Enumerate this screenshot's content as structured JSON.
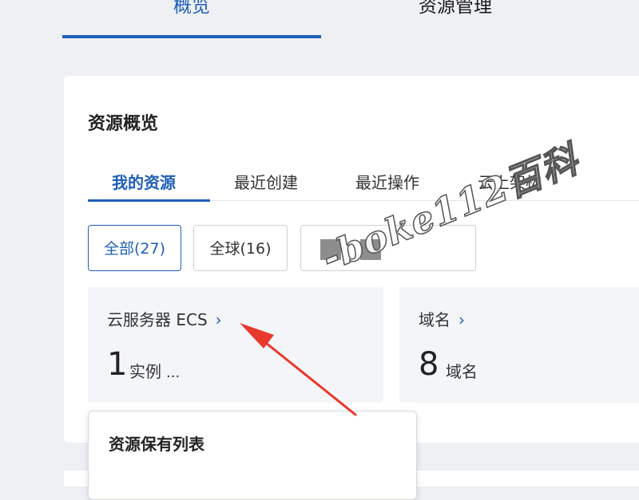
{
  "top_tabs": {
    "overview": "概览",
    "resource_management": "资源管理"
  },
  "main": {
    "title": "资源概览",
    "sub_tabs": [
      {
        "label": "我的资源"
      },
      {
        "label": "最近创建"
      },
      {
        "label": "最近操作"
      },
      {
        "label": "云上架构"
      }
    ],
    "filters": [
      {
        "label": "全部(27)"
      },
      {
        "label": "全球(16)"
      }
    ],
    "resources": [
      {
        "name": "云服务器 ECS",
        "arrow": "›",
        "count": "1",
        "unit": "实例",
        "more": "..."
      },
      {
        "name": "域名",
        "arrow": "›",
        "count": "8",
        "unit": "域名"
      }
    ]
  },
  "popover": {
    "title": "资源保有列表"
  },
  "watermark": "-boke112百科",
  "colors": {
    "accent": "#1f5fb8",
    "annotation_arrow": "#e8392d"
  }
}
